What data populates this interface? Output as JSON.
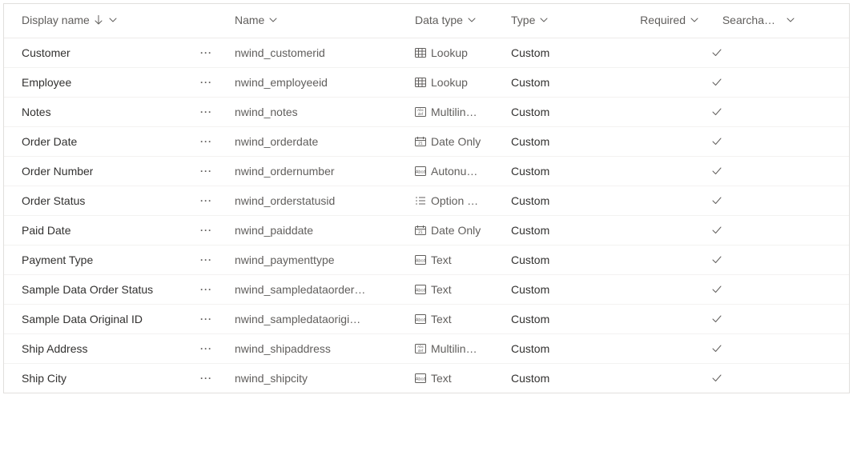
{
  "columns": {
    "displayName": "Display name",
    "name": "Name",
    "dataType": "Data type",
    "type": "Type",
    "required": "Required",
    "searchable": "Searcha…"
  },
  "rows": [
    {
      "displayName": "Customer",
      "name": "nwind_customerid",
      "dataTypeIcon": "lookup",
      "dataType": "Lookup",
      "type": "Custom",
      "required": "",
      "searchable": true
    },
    {
      "displayName": "Employee",
      "name": "nwind_employeeid",
      "dataTypeIcon": "lookup",
      "dataType": "Lookup",
      "type": "Custom",
      "required": "",
      "searchable": true
    },
    {
      "displayName": "Notes",
      "name": "nwind_notes",
      "dataTypeIcon": "multiline",
      "dataType": "Multilin…",
      "type": "Custom",
      "required": "",
      "searchable": true
    },
    {
      "displayName": "Order Date",
      "name": "nwind_orderdate",
      "dataTypeIcon": "date",
      "dataType": "Date Only",
      "type": "Custom",
      "required": "",
      "searchable": true
    },
    {
      "displayName": "Order Number",
      "name": "nwind_ordernumber",
      "dataTypeIcon": "autonum",
      "dataType": "Autonu…",
      "type": "Custom",
      "required": "",
      "searchable": true
    },
    {
      "displayName": "Order Status",
      "name": "nwind_orderstatusid",
      "dataTypeIcon": "optionset",
      "dataType": "Option …",
      "type": "Custom",
      "required": "",
      "searchable": true
    },
    {
      "displayName": "Paid Date",
      "name": "nwind_paiddate",
      "dataTypeIcon": "date",
      "dataType": "Date Only",
      "type": "Custom",
      "required": "",
      "searchable": true
    },
    {
      "displayName": "Payment Type",
      "name": "nwind_paymenttype",
      "dataTypeIcon": "text",
      "dataType": "Text",
      "type": "Custom",
      "required": "",
      "searchable": true
    },
    {
      "displayName": "Sample Data Order Status",
      "name": "nwind_sampledataorder…",
      "dataTypeIcon": "text",
      "dataType": "Text",
      "type": "Custom",
      "required": "",
      "searchable": true
    },
    {
      "displayName": "Sample Data Original ID",
      "name": "nwind_sampledataorigi…",
      "dataTypeIcon": "text",
      "dataType": "Text",
      "type": "Custom",
      "required": "",
      "searchable": true
    },
    {
      "displayName": "Ship Address",
      "name": "nwind_shipaddress",
      "dataTypeIcon": "multiline",
      "dataType": "Multilin…",
      "type": "Custom",
      "required": "",
      "searchable": true
    },
    {
      "displayName": "Ship City",
      "name": "nwind_shipcity",
      "dataTypeIcon": "text",
      "dataType": "Text",
      "type": "Custom",
      "required": "",
      "searchable": true
    }
  ],
  "actionsGlyph": "···"
}
